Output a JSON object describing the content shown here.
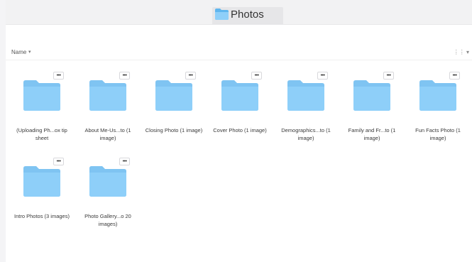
{
  "window": {
    "title": "Photos",
    "title_icon": "folder-icon"
  },
  "toolbar": {
    "sort_label": "Name",
    "sort_direction_icon": "chevron-down-icon",
    "view_toggle_icon": "grid-view-icon",
    "view_toggle_label": "⋮⋮ ▾"
  },
  "folders": [
    {
      "label": "(Uploading Ph...ox tip sheet",
      "more": "•••"
    },
    {
      "label": "About Me-Us...to (1 image)",
      "more": "•••"
    },
    {
      "label": "Closing Photo (1 image)",
      "more": "•••"
    },
    {
      "label": "Cover Photo (1 image)",
      "more": "•••"
    },
    {
      "label": "Demographics...to (1 image)",
      "more": "•••"
    },
    {
      "label": "Family and Fr...to (1 image)",
      "more": "•••"
    },
    {
      "label": "Fun Facts Photo (1 image)",
      "more": "•••"
    },
    {
      "label": "Intro Photos (3 images)",
      "more": "•••"
    },
    {
      "label": "Photo Gallery...o 20 images)",
      "more": "•••"
    }
  ],
  "colors": {
    "folder_body": "#8ecff9",
    "folder_tab": "#7fc4f2",
    "titlebar": "#f2f2f3"
  }
}
